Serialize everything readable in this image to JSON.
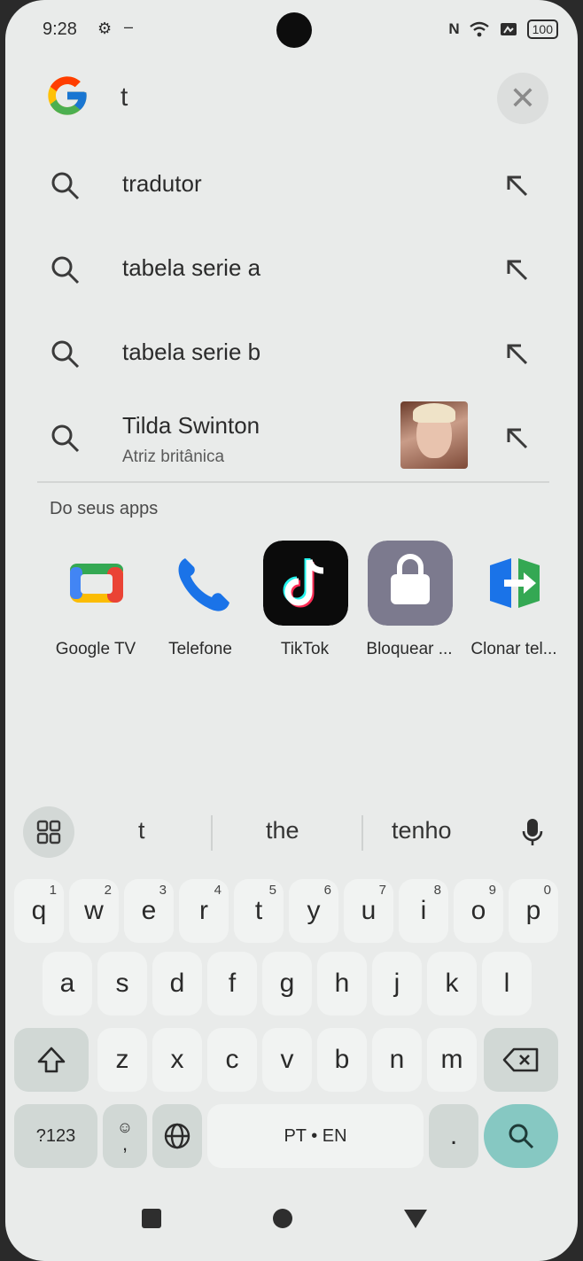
{
  "status": {
    "time": "9:28",
    "battery": "100"
  },
  "search": {
    "value": "t",
    "placeholder": ""
  },
  "suggestions": [
    {
      "text": "tradutor",
      "subtitle": ""
    },
    {
      "text": "tabela serie a",
      "subtitle": ""
    },
    {
      "text": "tabela serie b",
      "subtitle": ""
    },
    {
      "text": "Tilda Swinton",
      "subtitle": "Atriz britânica"
    }
  ],
  "apps_section": {
    "title": "Do seus apps",
    "apps": [
      {
        "label": "Google TV"
      },
      {
        "label": "Telefone"
      },
      {
        "label": "TikTok"
      },
      {
        "label": "Bloquear ..."
      },
      {
        "label": "Clonar tel..."
      }
    ]
  },
  "keyboard": {
    "suggestions": [
      "t",
      "the",
      "tenho"
    ],
    "row1": [
      {
        "k": "q",
        "n": "1"
      },
      {
        "k": "w",
        "n": "2"
      },
      {
        "k": "e",
        "n": "3"
      },
      {
        "k": "r",
        "n": "4"
      },
      {
        "k": "t",
        "n": "5"
      },
      {
        "k": "y",
        "n": "6"
      },
      {
        "k": "u",
        "n": "7"
      },
      {
        "k": "i",
        "n": "8"
      },
      {
        "k": "o",
        "n": "9"
      },
      {
        "k": "p",
        "n": "0"
      }
    ],
    "row2": [
      "a",
      "s",
      "d",
      "f",
      "g",
      "h",
      "j",
      "k",
      "l"
    ],
    "row3": [
      "z",
      "x",
      "c",
      "v",
      "b",
      "n",
      "m"
    ],
    "symbols_label": "?123",
    "emoji_comma": ",",
    "space_label": "PT • EN",
    "period": "."
  },
  "colors": {
    "accent": "#86c8c2",
    "screen_bg": "#e9ebea"
  },
  "icons": {
    "status": [
      "gear-icon",
      "nfc-icon",
      "wifi-icon",
      "sim-icon"
    ],
    "search": "search-icon",
    "arrow": "arrow-up-left-icon",
    "clear": "close-icon",
    "nav": [
      "recents-icon",
      "home-icon",
      "back-icon"
    ]
  }
}
